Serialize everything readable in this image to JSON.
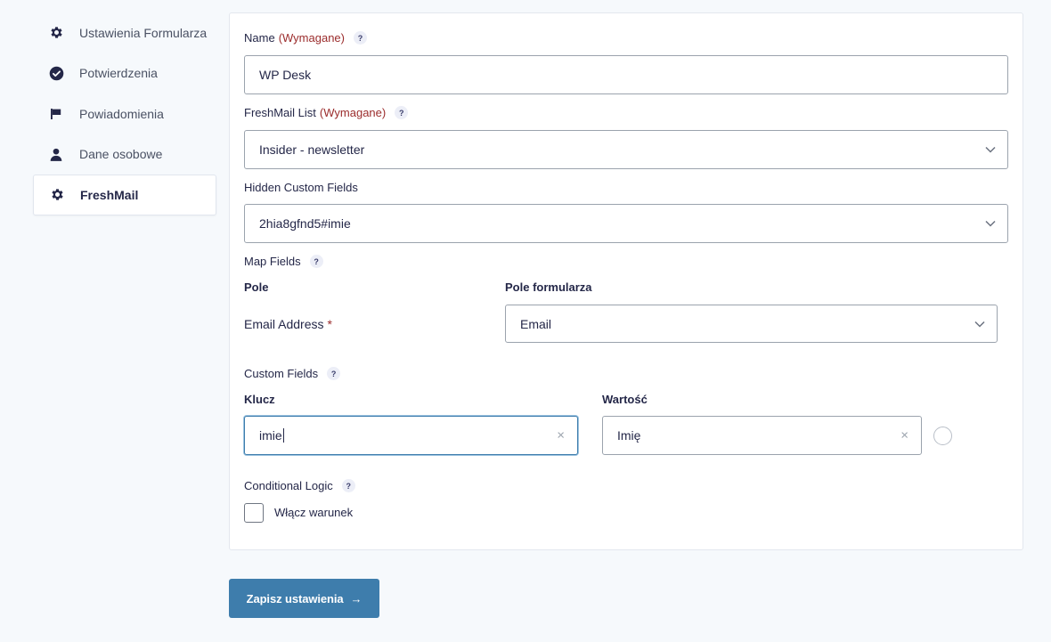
{
  "sidebar": {
    "items": [
      {
        "label": "Ustawienia Formularza",
        "icon": "gear-icon"
      },
      {
        "label": "Potwierdzenia",
        "icon": "check-circle-icon"
      },
      {
        "label": "Powiadomienia",
        "icon": "flag-icon"
      },
      {
        "label": "Dane osobowe",
        "icon": "user-icon"
      },
      {
        "label": "FreshMail",
        "icon": "gear-icon",
        "active": true
      }
    ]
  },
  "form": {
    "name": {
      "label": "Name",
      "required": "(Wymagane)",
      "help": "?",
      "value": "WP Desk"
    },
    "list": {
      "label": "FreshMail List",
      "required": "(Wymagane)",
      "help": "?",
      "value": "Insider - newsletter"
    },
    "hidden_fields": {
      "label": "Hidden Custom Fields",
      "value": "2hia8gfnd5#imie"
    },
    "map_fields": {
      "label": "Map Fields",
      "help": "?",
      "col_field": "Pole",
      "col_form_field": "Pole formularza",
      "rows": [
        {
          "field": "Email Address",
          "required_mark": "*",
          "value": "Email"
        }
      ]
    },
    "custom_fields": {
      "label": "Custom Fields",
      "help": "?",
      "col_key": "Klucz",
      "col_value": "Wartość",
      "rows": [
        {
          "key": "imie",
          "value": "Imię",
          "clear": "×"
        }
      ]
    },
    "conditional": {
      "label": "Conditional Logic",
      "help": "?",
      "checkbox_label": "Włącz warunek",
      "checked": false
    }
  },
  "save_button": {
    "label": "Zapisz ustawienia",
    "arrow": "→"
  },
  "colors": {
    "accent": "#3e7dac",
    "required": "#9b2c2c",
    "text": "#242748",
    "background": "#f6f9fc"
  }
}
